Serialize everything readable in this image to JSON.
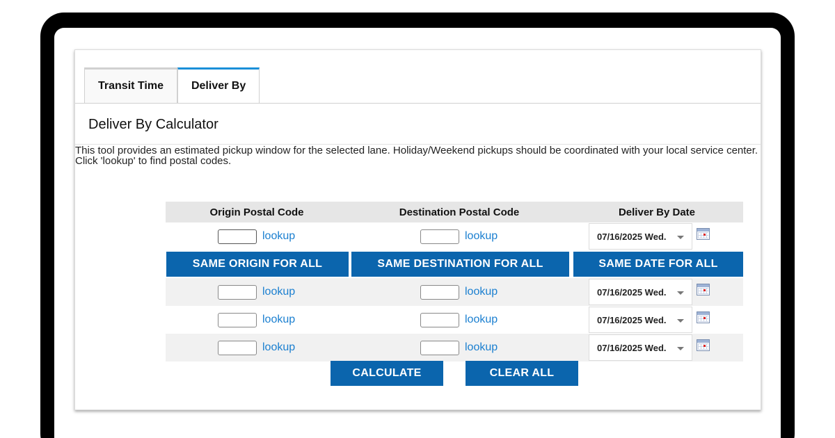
{
  "tabs": [
    {
      "label": "Transit Time",
      "active": false
    },
    {
      "label": "Deliver By",
      "active": true
    }
  ],
  "calculator": {
    "title": "Deliver By Calculator",
    "description": "This tool provides an estimated pickup window for the selected lane. Holiday/Weekend pickups should be coordinated with your local service center. Click 'lookup' to find postal codes."
  },
  "columns": {
    "origin": "Origin Postal Code",
    "destination": "Destination Postal Code",
    "date": "Deliver By Date"
  },
  "lookup_label": "lookup",
  "rows": [
    {
      "origin": "",
      "destination": "",
      "date": "07/16/2025 Wed."
    },
    {
      "origin": "",
      "destination": "",
      "date": "07/16/2025 Wed."
    },
    {
      "origin": "",
      "destination": "",
      "date": "07/16/2025 Wed."
    },
    {
      "origin": "",
      "destination": "",
      "date": "07/16/2025 Wed."
    }
  ],
  "bulk_buttons": {
    "same_origin": "SAME ORIGIN FOR ALL",
    "same_destination": "SAME DESTINATION FOR ALL",
    "same_date": "SAME DATE FOR ALL"
  },
  "actions": {
    "calculate": "CALCULATE",
    "clear_all": "CLEAR ALL"
  },
  "icons": {
    "date_dropdown": "chevron-down-icon",
    "calendar": "calendar-icon"
  },
  "colors": {
    "accent": "#1a8fd8",
    "button_blue": "#0b65ad",
    "link_blue": "#1a7fd0",
    "header_gray": "#e6e6e6",
    "row_alt": "#f1f1f1"
  }
}
